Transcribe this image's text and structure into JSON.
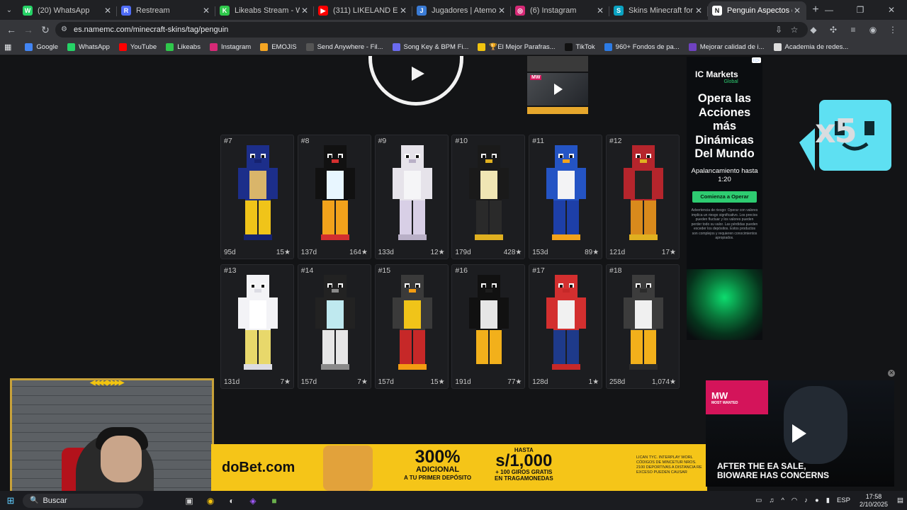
{
  "tabs": [
    {
      "title": "(20) WhatsApp",
      "icon": "whatsapp-icon",
      "color": "#25d366",
      "glyph": "W"
    },
    {
      "title": "Restream",
      "icon": "restream-icon",
      "color": "#4f6cf7",
      "glyph": "R"
    },
    {
      "title": "Likeabs Stream - Watch L",
      "icon": "likeabs-icon",
      "color": "#2fc84b",
      "glyph": "K"
    },
    {
      "title": "(311) LIKELAND Ep. 2 \"UI",
      "icon": "youtube-icon",
      "color": "#ff0000",
      "glyph": "▶"
    },
    {
      "title": "Jugadores | Atemos | Serv",
      "icon": "namemc-tab-icon",
      "color": "#3a7bd5",
      "glyph": "J"
    },
    {
      "title": "(6) Instagram",
      "icon": "instagram-icon",
      "color": "#d62976",
      "glyph": "◎"
    },
    {
      "title": "Skins Minecraft for boys",
      "icon": "skins-tab-icon",
      "color": "#0aa3c2",
      "glyph": "S"
    },
    {
      "title": "Penguin Aspectos de Min",
      "icon": "namemc-active-tab-icon",
      "color": "#ffffff",
      "glyph": "N",
      "active": true
    }
  ],
  "address": {
    "url": "es.namemc.com/minecraft-skins/tag/penguin"
  },
  "bookmarks": [
    {
      "label": "Google",
      "color": "#4285f4"
    },
    {
      "label": "WhatsApp",
      "color": "#25d366"
    },
    {
      "label": "YouTube",
      "color": "#ff0000"
    },
    {
      "label": "Likeabs",
      "color": "#2fc84b"
    },
    {
      "label": "Instagram",
      "color": "#d62976"
    },
    {
      "label": "EMOJIS",
      "color": "#f5a623"
    },
    {
      "label": "Send Anywhere - Fil...",
      "color": "#555555"
    },
    {
      "label": "Song Key & BPM Fi...",
      "color": "#6b6bf0"
    },
    {
      "label": "🏆El Mejor Parafras...",
      "color": "#f1c40f"
    },
    {
      "label": "TikTok",
      "color": "#111111"
    },
    {
      "label": "960+ Fondos de pa...",
      "color": "#2c7be5"
    },
    {
      "label": "Mejorar calidad de i...",
      "color": "#6f42c1"
    },
    {
      "label": "Academia de redes...",
      "color": "#dddddd"
    }
  ],
  "skins": [
    {
      "rank": "#7",
      "age": "95d",
      "stars": "15★",
      "palette": [
        "#1c2e8a",
        "#d9b56a",
        "#f0c419",
        "#152270"
      ]
    },
    {
      "rank": "#8",
      "age": "137d",
      "stars": "164★",
      "palette": [
        "#111111",
        "#e8f6ff",
        "#f2a21b",
        "#d32f2f"
      ]
    },
    {
      "rank": "#9",
      "age": "133d",
      "stars": "12★",
      "palette": [
        "#e6e3ea",
        "#f5f5f7",
        "#d8cfe6",
        "#b9b0c7"
      ]
    },
    {
      "rank": "#10",
      "age": "179d",
      "stars": "428★",
      "palette": [
        "#1a1a1a",
        "#f0e6b4",
        "#2a2a2a",
        "#e0b020"
      ]
    },
    {
      "rank": "#11",
      "age": "153d",
      "stars": "89★",
      "palette": [
        "#2454c4",
        "#f3f3f5",
        "#1d3fa8",
        "#f2a21b"
      ]
    },
    {
      "rank": "#12",
      "age": "121d",
      "stars": "17★",
      "palette": [
        "#b5252c",
        "#222222",
        "#d98a1c",
        "#e0b020"
      ]
    },
    {
      "rank": "#13",
      "age": "131d",
      "stars": "7★",
      "palette": [
        "#f3f3f6",
        "#ffffff",
        "#e8d86b",
        "#dcdce4"
      ]
    },
    {
      "rank": "#14",
      "age": "157d",
      "stars": "7★",
      "palette": [
        "#222222",
        "#bfe9ef",
        "#e6e6e6",
        "#8a8a8a"
      ]
    },
    {
      "rank": "#15",
      "age": "157d",
      "stars": "15★",
      "palette": [
        "#3a3a3a",
        "#f0c419",
        "#c62828",
        "#f39c12"
      ]
    },
    {
      "rank": "#16",
      "age": "191d",
      "stars": "77★",
      "palette": [
        "#111111",
        "#e6e6e6",
        "#f2b01b",
        "#1c1c1c"
      ]
    },
    {
      "rank": "#17",
      "age": "128d",
      "stars": "1★",
      "palette": [
        "#d32f2f",
        "#f1f1f1",
        "#1e3a8a",
        "#c62828"
      ]
    },
    {
      "rank": "#18",
      "age": "258d",
      "stars": "1,074★",
      "palette": [
        "#3c3c3c",
        "#f0f0f0",
        "#f2b01b",
        "#2b2b2b"
      ]
    }
  ],
  "ad": {
    "brand": "IC Markets",
    "brand_sub": "Global",
    "headline": "Opera las Acciones más Dinámicas Del Mundo",
    "subline": "Apalancamiento hasta 1:20",
    "cta": "Comienza a Operar",
    "fineprint": "Advertencia de riesgo: Operar con valores implica un riesgo significativo. Los precios pueden fluctuar y los valores pueden perder todo su valor. Las pérdidas pueden exceder los depósitos. Estos productos son complejos y requieren conocimientos apropiados."
  },
  "overlay": {
    "multiplier": "x5"
  },
  "banner": {
    "logo": "doBet.com",
    "percent": "300%",
    "percent_sub": "ADICIONAL",
    "percent_sub2": "A TU PRIMER DEPÓSITO",
    "money_top": "HASTA",
    "money": "s/1,000",
    "money_sub": "+ 100 GIROS GRATIS",
    "money_sub2": "EN TRAGAMONEDAS",
    "legal": "LICAN TYC. INTERPLAY WORL CÓDIGOS DE MINCETUR NROS. 2100 DEPORTIVAS A DISTANCIA RE EXCESO PUEDEN CAUSAR"
  },
  "video_ad": {
    "logo": "MW",
    "logo_sub": "MOST WANTED",
    "caption_line1": "AFTER THE EA SALE,",
    "caption_line2": "BIOWARE HAS CONCERNS"
  },
  "taskbar": {
    "search_label": "Buscar",
    "lang": "ESP",
    "time": "17:58",
    "date": "2/10/2025"
  }
}
